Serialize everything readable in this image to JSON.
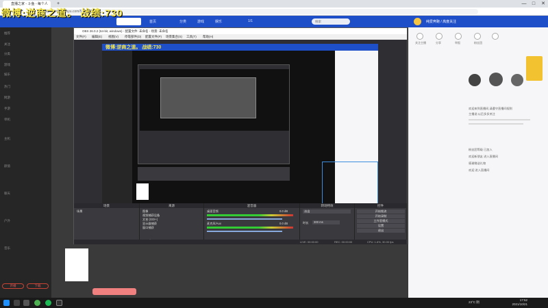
{
  "browser": {
    "tab_title": "直播之家 - 斗鱼 - 每个人的直播平台",
    "url": "https://www.douyu.com/5131145",
    "back": "←",
    "forward": "→",
    "reload": "⟳",
    "home": "⌂",
    "minimize": "—",
    "maximize": "□",
    "close": "✕",
    "new_tab": "+"
  },
  "stream_overlay": {
    "title": "微博:逆商之道。 战绩:730"
  },
  "site_header": {
    "nav": [
      "首页",
      "分类",
      "游戏",
      "娱乐",
      "1/1"
    ],
    "search_placeholder": "搜索",
    "follow_label": "纯爱奔跑 / 高度关注"
  },
  "sidebar": {
    "items": [
      "推荐",
      "关注",
      "分类",
      "游戏",
      "娱乐",
      "热门",
      "网游",
      "手游",
      "单机",
      "主机",
      "颜值",
      "聊天",
      "户外",
      "音乐"
    ],
    "btn_stream": "开播",
    "btn_cloud": "下载"
  },
  "obs": {
    "window_title": "OBS 26.0.2 (64-bit, windows) - 配置文件: 未命名 - 场景: 未命名",
    "menu": [
      "文件(F)",
      "编辑(E)",
      "视图(V)",
      "停靠部件(D)",
      "配置文件(P)",
      "场景集合(S)",
      "工具(T)",
      "帮助(H)"
    ],
    "docks": {
      "scenes": {
        "title": "场景",
        "items": [
          "场景"
        ]
      },
      "sources": {
        "title": "来源",
        "items": [
          "图像",
          "视频捕获设备",
          "文本 (GDI+)",
          "显示器捕获",
          "窗口捕获"
        ]
      },
      "mixer": {
        "title": "混音器",
        "channels": [
          "桌面音频",
          "麦克风/Aux"
        ],
        "levels": [
          "0.0 dB",
          "0.0 dB"
        ]
      },
      "transitions": {
        "title": "转场特效",
        "type": "淡出",
        "duration_label": "时长",
        "duration": "300 ms"
      },
      "controls": {
        "title": "控件",
        "buttons": [
          "开始推流",
          "开始录制",
          "工作室模式",
          "设置",
          "退出"
        ]
      }
    },
    "status": {
      "live": "LIVE: 00:00:00",
      "rec": "REC: 00:00:00",
      "cpu": "CPU: 1.6%, 30.00 fps"
    }
  },
  "right_panel": {
    "chat": [
      "欢迎来到直播间,请遵守直播间规则",
      "主播说:以后多多关注",
      "粉丝团等级 已加入",
      "欢迎新朋友 进入直播间",
      "感谢赠送礼物",
      "欢迎 进入直播间"
    ],
    "ticker": [
      "关注主播",
      "分享",
      "举报",
      "粉丝团"
    ]
  },
  "taskbar": {
    "weather": "23°C 阴",
    "time": "17:52",
    "date": "2021/10/21"
  },
  "colors": {
    "header": "#1e4ec8",
    "overlay_text": "#f7e84e",
    "obs_bg": "#2f2f33",
    "taskbar": "#1a1a1a"
  }
}
